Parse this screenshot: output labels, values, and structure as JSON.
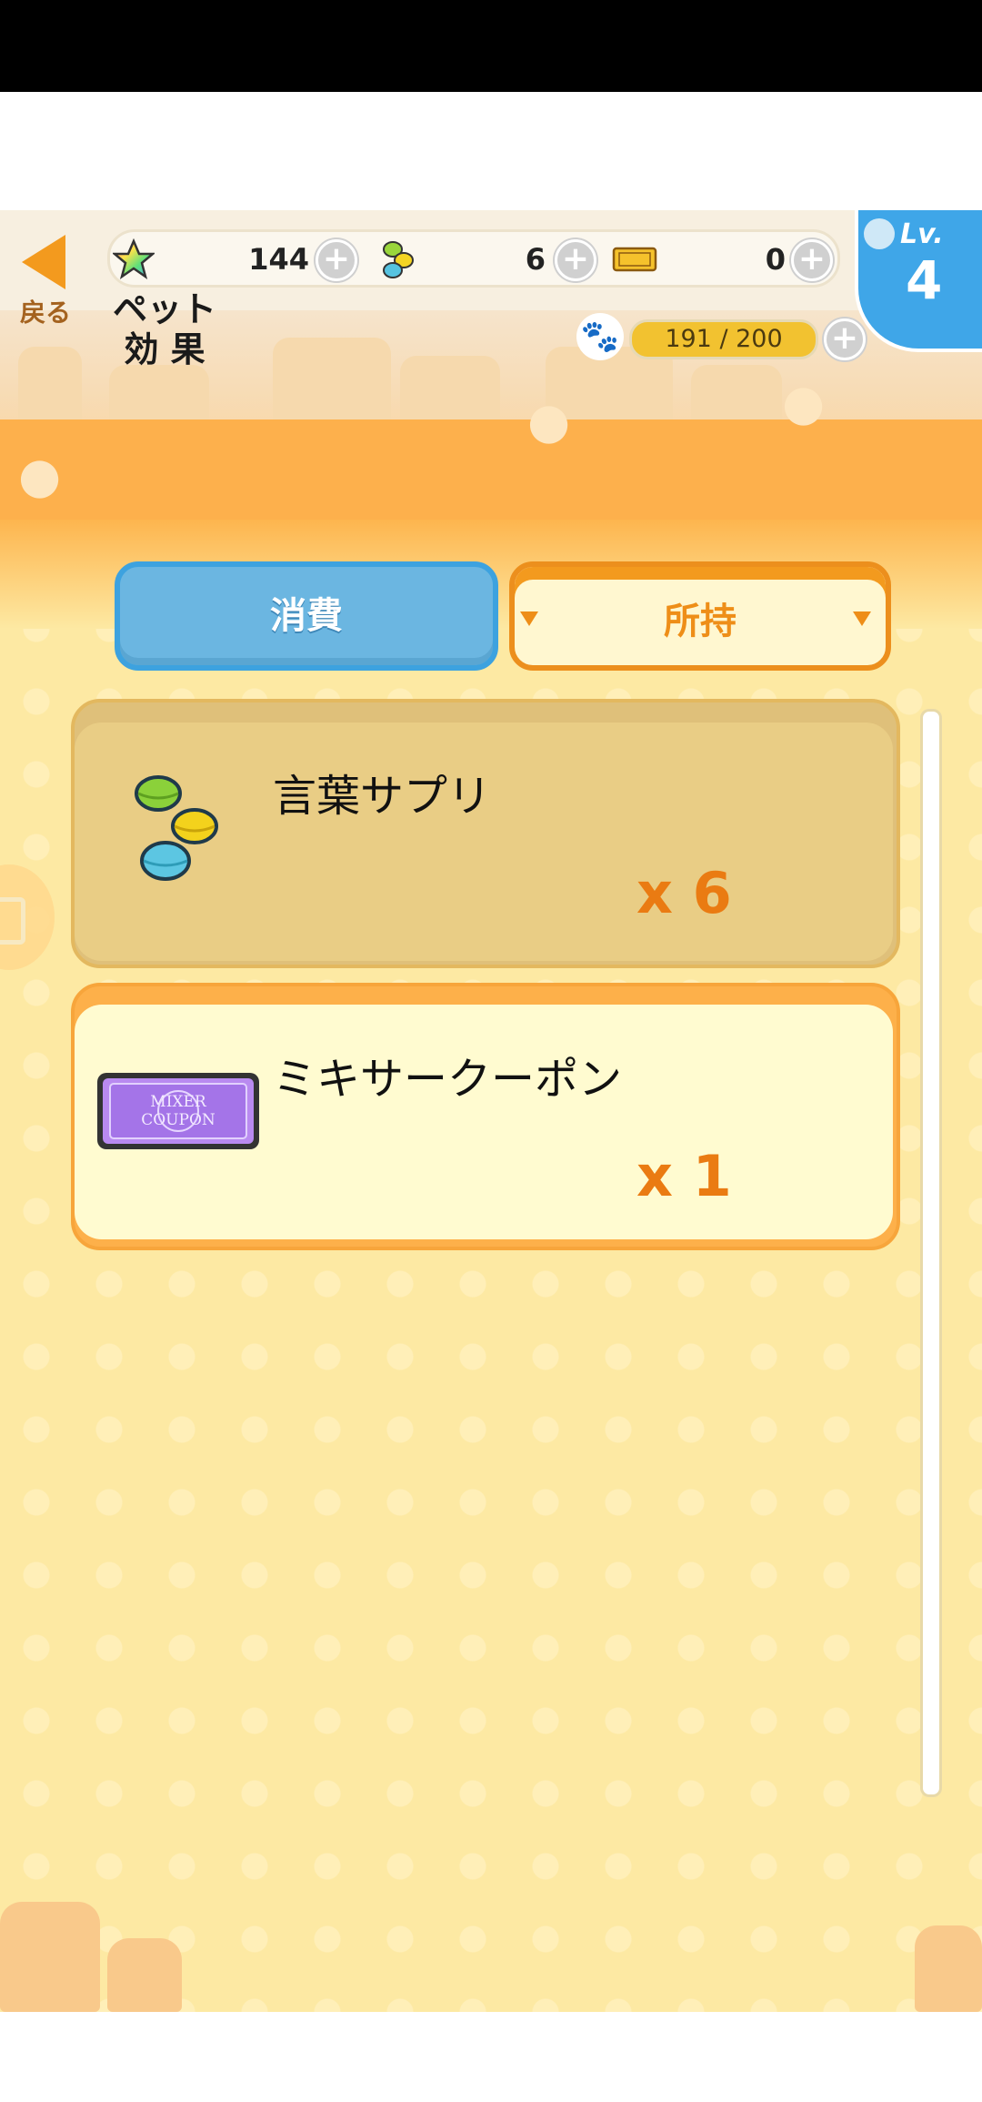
{
  "header": {
    "back_label": "戻る",
    "title_line1": "ペット",
    "title_line2": "効 果",
    "resources": {
      "stars": "144",
      "supplements": "6",
      "coupons": "0"
    },
    "paw_progress": {
      "text": "191 / 200",
      "fraction": 0.955
    },
    "level_label": "Lv.",
    "level_value": "4"
  },
  "tabs": {
    "consume_label": "消費",
    "owned_label": "所持"
  },
  "items": [
    {
      "name": "言葉サプリ",
      "quantity": "x 6",
      "icon": "colored-macaron-supplement-icon"
    },
    {
      "name": "ミキサークーポン",
      "quantity": "x 1",
      "icon": "mixer-coupon-ticket-icon",
      "ticket_text_1": "MIXER",
      "ticket_text_2": "COUPON"
    }
  ],
  "colors": {
    "accent_orange": "#f39a1e",
    "tab_blue": "#6bb6e1",
    "level_blue": "#3fa6e8",
    "quantity_orange": "#ea7b12",
    "paw_bar_gold": "#f2c230"
  }
}
